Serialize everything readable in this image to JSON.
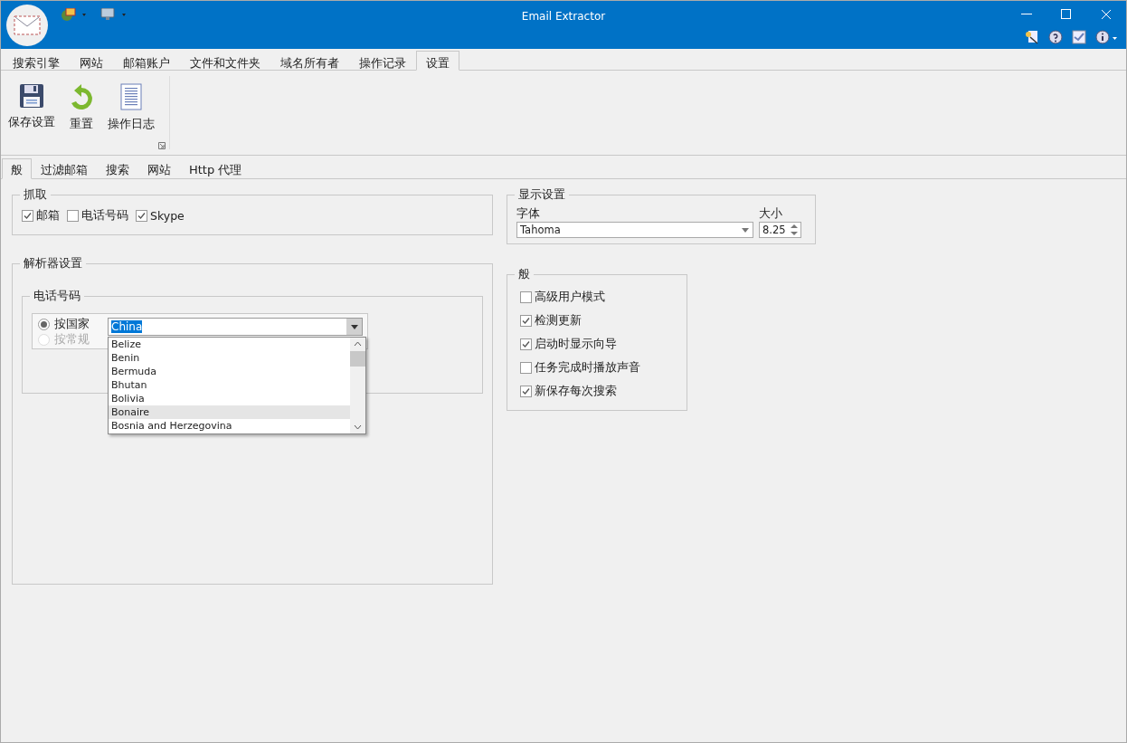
{
  "window": {
    "title": "Email Extractor"
  },
  "ribbon": {
    "tabs": [
      {
        "label": "搜索引擎",
        "selected": false
      },
      {
        "label": "网站",
        "selected": false
      },
      {
        "label": "邮箱账户",
        "selected": false
      },
      {
        "label": "文件和文件夹",
        "selected": false
      },
      {
        "label": "域名所有者",
        "selected": false
      },
      {
        "label": "操作记录",
        "selected": false
      },
      {
        "label": "设置",
        "selected": true
      }
    ],
    "buttons": [
      {
        "label": "保存设置",
        "kind": "save"
      },
      {
        "label": "重置",
        "kind": "reset"
      },
      {
        "label": "操作日志",
        "kind": "log"
      }
    ]
  },
  "settings_tabs": [
    {
      "label": "般",
      "selected": true
    },
    {
      "label": "过滤邮箱",
      "selected": false
    },
    {
      "label": "搜索",
      "selected": false
    },
    {
      "label": "网站",
      "selected": false
    },
    {
      "label": "Http 代理",
      "selected": false
    }
  ],
  "capture": {
    "title": "抓取",
    "options": [
      {
        "label": "邮箱",
        "checked": true
      },
      {
        "label": "电话号码",
        "checked": false
      },
      {
        "label": "Skype",
        "checked": true
      }
    ]
  },
  "parser": {
    "title": "解析器设置",
    "phone": {
      "title": "电话号码",
      "modes": [
        {
          "label": "按国家",
          "selected": true,
          "disabled": false
        },
        {
          "label": "按常规",
          "selected": false,
          "disabled": true
        }
      ],
      "country": {
        "value": "China"
      },
      "dropdown": {
        "items": [
          {
            "label": "Belize",
            "hovered": false
          },
          {
            "label": "Benin",
            "hovered": false
          },
          {
            "label": "Bermuda",
            "hovered": false
          },
          {
            "label": "Bhutan",
            "hovered": false
          },
          {
            "label": "Bolivia",
            "hovered": false
          },
          {
            "label": "Bonaire",
            "hovered": true
          },
          {
            "label": "Bosnia and Herzegovina",
            "hovered": false
          }
        ]
      }
    }
  },
  "display": {
    "title": "显示设置",
    "font_label": "字体",
    "font_value": "Tahoma",
    "size_label": "大小",
    "size_value": "8.25"
  },
  "general": {
    "title": "般",
    "options": [
      {
        "label": "高级用户模式",
        "checked": false
      },
      {
        "label": "检测更新",
        "checked": true
      },
      {
        "label": "启动时显示向导",
        "checked": true
      },
      {
        "label": "任务完成时播放声音",
        "checked": false
      },
      {
        "label": "新保存每次搜索",
        "checked": true
      }
    ]
  }
}
